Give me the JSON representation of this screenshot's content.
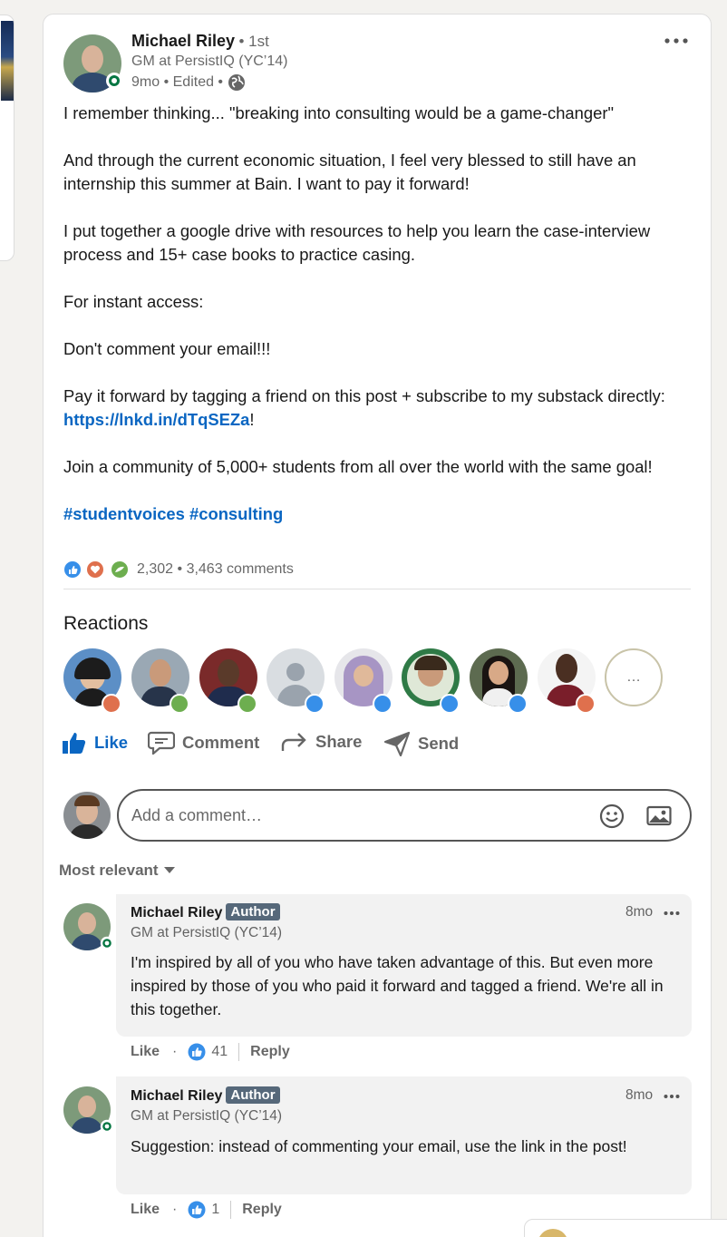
{
  "post": {
    "author": {
      "name": "Michael Riley",
      "degree": "• 1st",
      "headline": "GM at PersistIQ (YC’14)",
      "time": "9mo • Edited •"
    },
    "more_icon": "ellipsis-icon",
    "paragraphs": [
      "I remember thinking... \"breaking into consulting would be a game-changer\"",
      "And through the current economic situation, I feel very blessed to still have an internship this summer at Bain. I want to pay it forward!",
      "I put together a google drive with resources to help you learn the case-interview process and 15+ case books to practice casing.",
      "For instant access:",
      "Don't comment your email!!!",
      "Pay it forward by tagging a friend on this post + subscribe to my substack directly:"
    ],
    "link_text": "https://lnkd.in/dTqSEZa",
    "link_suffix": "!",
    "closing": "Join a community of 5,000+ students from all over the world with the same goal!",
    "hashtags": "#studentvoices #consulting",
    "reaction_count": "2,302",
    "separator": "•",
    "comment_count": "3,463 comments"
  },
  "reactions": {
    "heading": "Reactions",
    "more_label": "…"
  },
  "actions": {
    "like": "Like",
    "comment": "Comment",
    "share": "Share",
    "send": "Send"
  },
  "comment_input": {
    "placeholder": "Add a comment…"
  },
  "sort": {
    "label": "Most relevant"
  },
  "comments": [
    {
      "name": "Michael Riley",
      "badge": "Author",
      "headline": "GM at PersistIQ (YC’14)",
      "time": "8mo",
      "text": "I'm inspired by all of you who have taken advantage of this. But even more inspired by those of you who paid it forward and tagged a friend. We're all in this together.",
      "like": "Like",
      "dot": "·",
      "likes": "41",
      "reply": "Reply"
    },
    {
      "name": "Michael Riley",
      "badge": "Author",
      "headline": "GM at PersistIQ (YC’14)",
      "time": "8mo",
      "text": "Suggestion: instead of commenting your email, use the link in the post!",
      "like": "Like",
      "dot": "·",
      "likes": "1",
      "reply": "Reply"
    }
  ],
  "colors": {
    "brand_blue": "#0a66c2",
    "online_green": "#057642",
    "author_badge": "#56687a"
  }
}
